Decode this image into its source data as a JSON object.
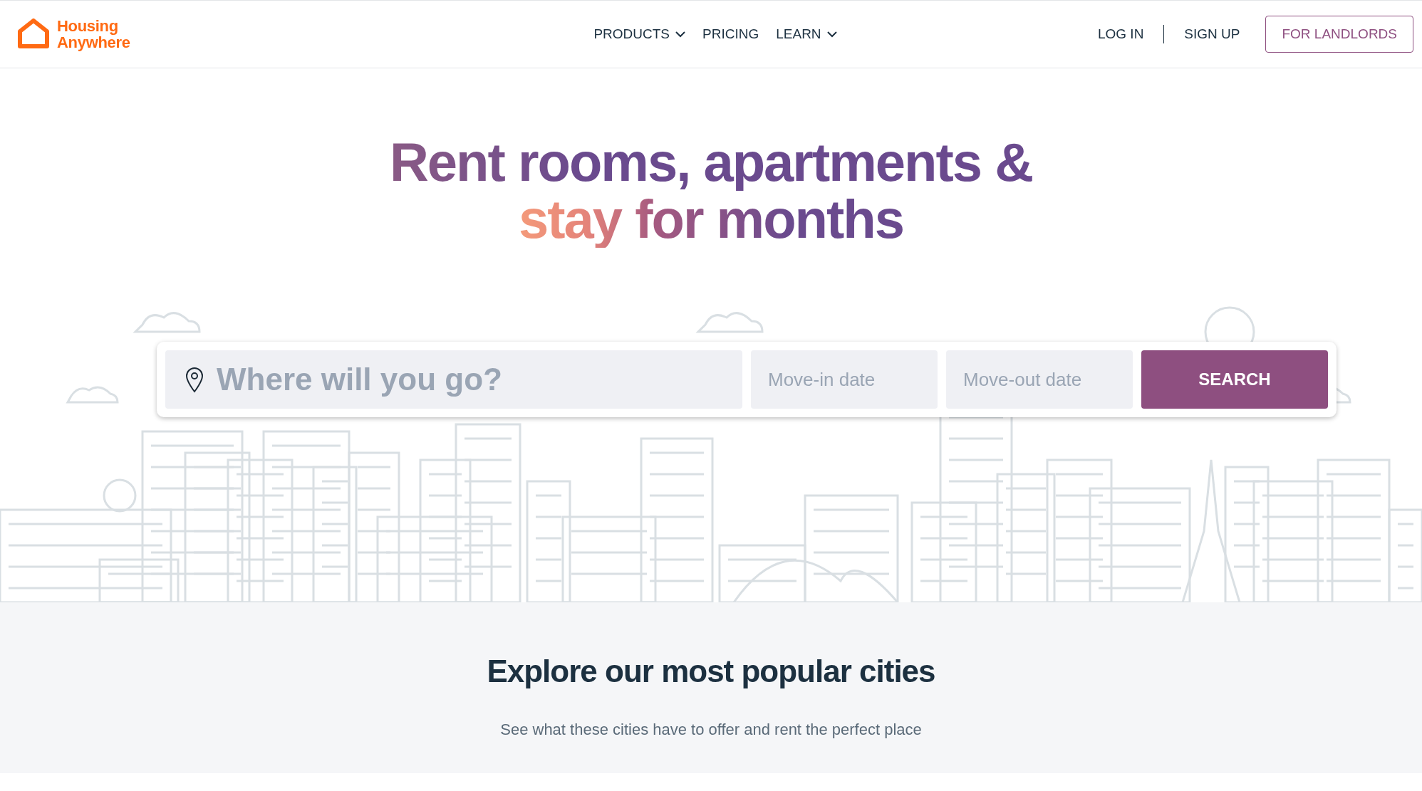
{
  "header": {
    "logo": [
      "Housing",
      "Anywhere"
    ],
    "nav": [
      {
        "label": "PRODUCTS",
        "dropdown": true
      },
      {
        "label": "PRICING",
        "dropdown": false
      },
      {
        "label": "LEARN",
        "dropdown": true
      }
    ],
    "auth": [
      "LOG IN",
      "SIGN UP"
    ],
    "cta": "FOR LANDLORDS"
  },
  "hero": {
    "headline": [
      "Rent rooms, apartments &",
      "stay for months"
    ],
    "search": {
      "location_placeholder": "Where will you go?",
      "move_in_placeholder": "Move-in date",
      "move_out_placeholder": "Move-out date",
      "button": "SEARCH"
    }
  },
  "popular": {
    "title": "Explore our most popular cities",
    "subtitle": "See what these cities have to offer and rent the perfect place"
  }
}
